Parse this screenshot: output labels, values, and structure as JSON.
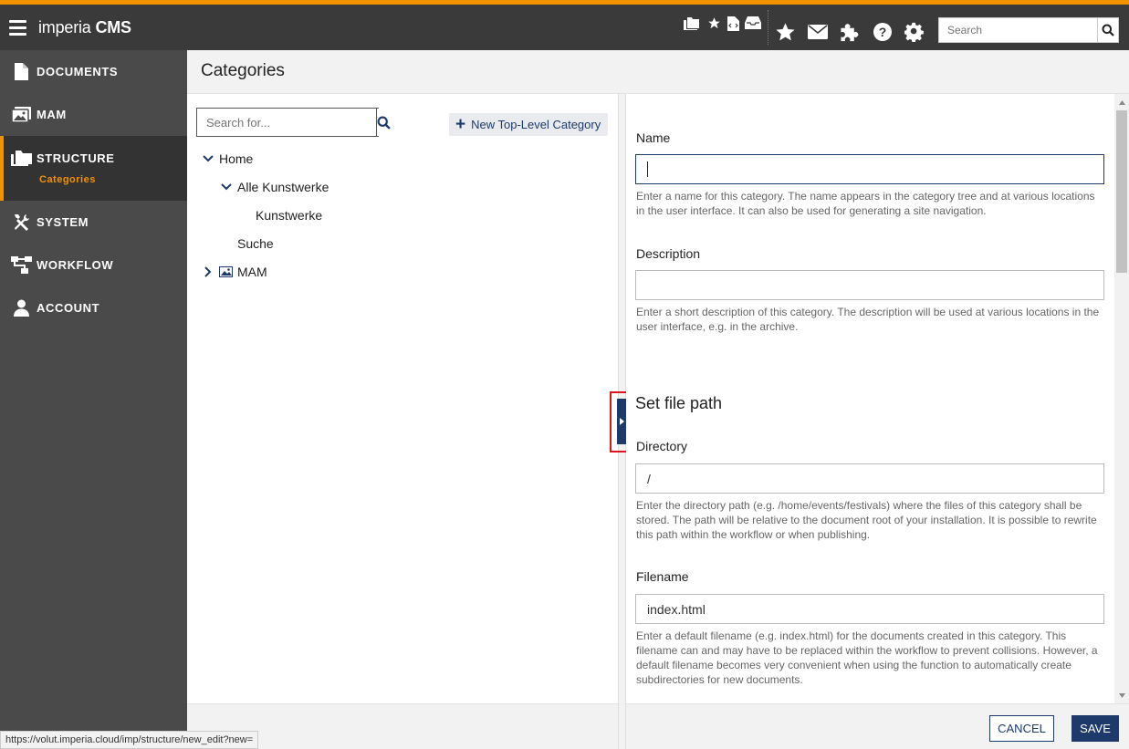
{
  "app": {
    "brand_light": "imperia",
    "brand_bold": "CMS"
  },
  "topbar": {
    "search_placeholder": "Search",
    "icons": [
      "folders-icon",
      "star-small-icon",
      "document-code-icon",
      "inbox-icon",
      "star-icon",
      "mail-icon",
      "puzzle-icon",
      "help-icon",
      "gear-icon"
    ]
  },
  "sidebar": {
    "items": [
      {
        "label": "DOCUMENTS",
        "icon": "document-icon"
      },
      {
        "label": "MAM",
        "icon": "images-icon"
      },
      {
        "label": "STRUCTURE",
        "icon": "folders-icon",
        "active": true,
        "sub": "Categories"
      },
      {
        "label": "SYSTEM",
        "icon": "tools-icon"
      },
      {
        "label": "WORKFLOW",
        "icon": "workflow-icon"
      },
      {
        "label": "ACCOUNT",
        "icon": "user-icon"
      }
    ]
  },
  "page": {
    "title": "Categories"
  },
  "tree": {
    "search_placeholder": "Search for...",
    "new_button": "New Top-Level Category",
    "nodes": [
      "Home",
      "Alle Kunstwerke",
      "Kunstwerke",
      "Suche",
      "MAM"
    ]
  },
  "form": {
    "name_label": "Name",
    "name_value": "",
    "name_help": "Enter a name for this category. The name appears in the category tree and at various locations in the user interface. It can also be used for generating a site navigation.",
    "description_label": "Description",
    "description_value": "",
    "description_help": "Enter a short description of this category. The description will be used at various locations in the user interface, e.g. in the archive.",
    "section_title": "Set file path",
    "directory_label": "Directory",
    "directory_value": "/",
    "directory_help": "Enter the directory path (e.g. /home/events/festivals) where the files of this category shall be stored. The path will be relative to the document root of your installation. It is possible to rewrite this path within the workflow or when publishing.",
    "filename_label": "Filename",
    "filename_value": "index.html",
    "filename_help": "Enter a default filename (e.g. index.html) for the documents created in this category. This filename can and may have to be replaced within the workflow to prevent collisions. However, a default filename becomes very convenient when using the function to automatically create subdirectories for new documents."
  },
  "footer": {
    "cancel": "CANCEL",
    "save": "SAVE"
  },
  "status_url": "https://volut.imperia.cloud/imp/structure/new_edit?new=",
  "colors": {
    "accent": "#f39200",
    "primary": "#1d3a6b",
    "topbar": "#3a3a3a",
    "sidebar": "#4a4a4a",
    "highlight": "#e0141e"
  }
}
